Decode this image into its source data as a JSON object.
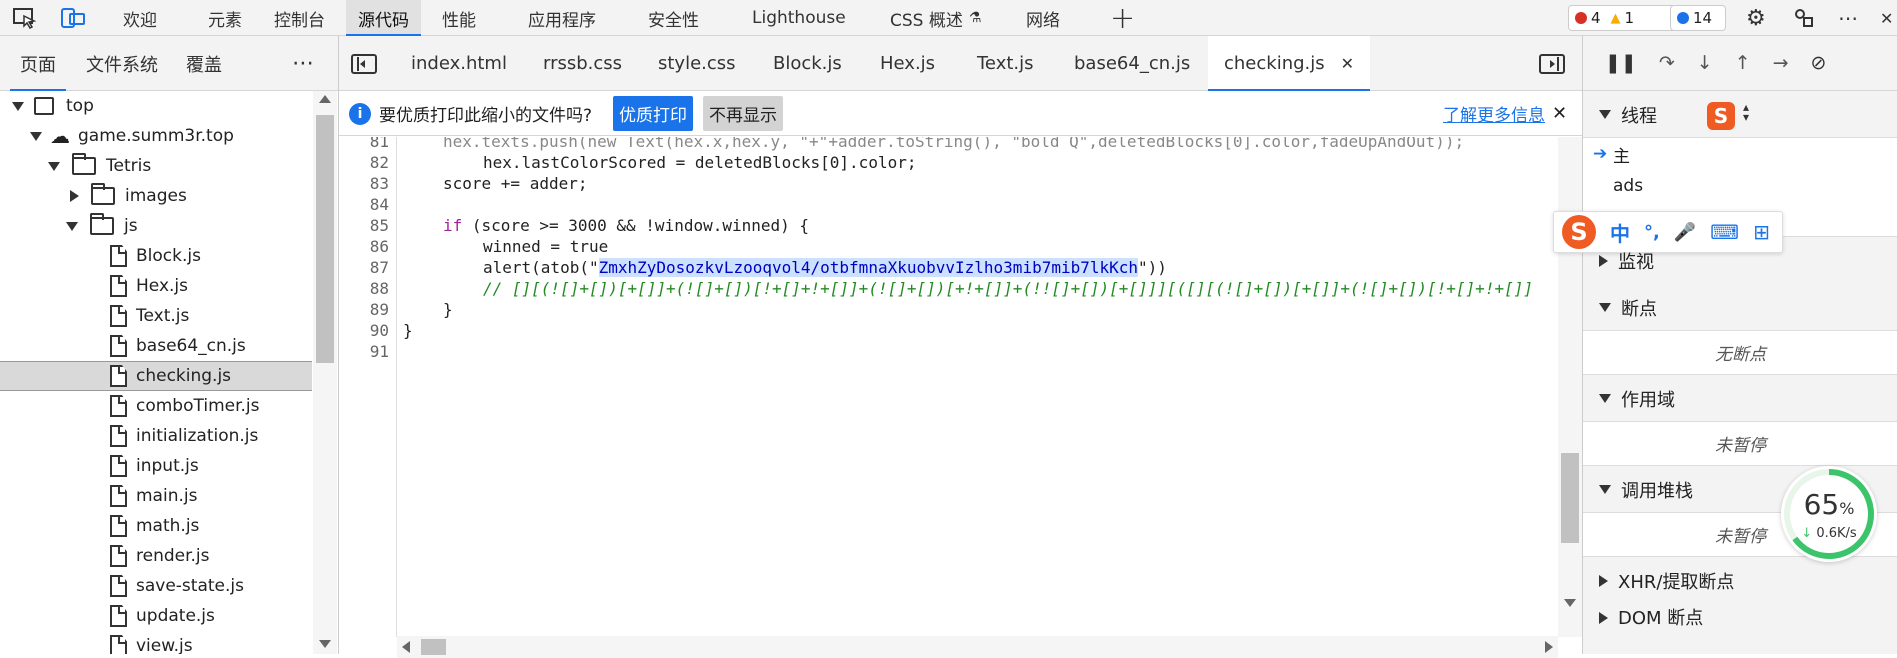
{
  "panel_tabs": [
    "欢迎",
    "元素",
    "控制台",
    "源代码",
    "性能",
    "应用程序",
    "安全性",
    "Lighthouse",
    "CSS 概述",
    "网络"
  ],
  "badges": {
    "errors": "4",
    "warnings": "1",
    "messages": "14"
  },
  "left": {
    "tabs": [
      "页面",
      "文件系统",
      "覆盖"
    ],
    "tree": [
      "top",
      "game.summ3r.top",
      "Tetris",
      "images",
      "js",
      "Block.js",
      "Hex.js",
      "Text.js",
      "base64_cn.js",
      "checking.js",
      "comboTimer.js",
      "initialization.js",
      "input.js",
      "main.js",
      "math.js",
      "render.js",
      "save-state.js",
      "update.js",
      "view.js"
    ]
  },
  "file_tabs": [
    "index.html",
    "rrssb.css",
    "style.css",
    "Block.js",
    "Hex.js",
    "Text.js",
    "base64_cn.js",
    "checking.js"
  ],
  "infobar": {
    "text": "要优质打印此缩小的文件吗?",
    "primary": "优质打印",
    "secondary": "不再显示",
    "link": "了解更多信息"
  },
  "code": {
    "partial": "hex.texts.push(new Text(hex.x,hex.y, \"+\"+adder.toString(), \"bold Q\",deletedBlocks[0].color,fadeUpAndOut));",
    "numbers": [
      "81",
      "82",
      "83",
      "84",
      "85",
      "86",
      "87",
      "88",
      "89",
      "90",
      "91"
    ],
    "line82": "hex.lastColorScored = deletedBlocks[0].color;",
    "line83": "score += adder;",
    "cond": "(score >= 3000 && !window.winned) {",
    "winned": "winned = true",
    "alert_pre": "alert(atob(\"",
    "alert_str": "ZmxhZyDosozkvLzooqvol4/otbfmnaXkuobvvIzlho3mib7mib7lkKch",
    "alert_post": "\"))",
    "comment": "// [][(![]+[])[+[]]+(![]+[])[!+[]+!+[]]+(![]+[])[+!+[]]+(!![]+[])[+[]]][([][(![]+[])[+[]]+(![]+[])[!+[]+!+[]]",
    "close1": "}",
    "close2": "}"
  },
  "right": {
    "threads": "线程",
    "main": "主",
    "ads": "ads",
    "watch": "监视",
    "breakpoints": "断点",
    "no_bp": "无断点",
    "scope": "作用域",
    "not_paused": "未暂停",
    "callstack": "调用堆栈",
    "not_paused2": "未暂停",
    "xhr": "XHR/提取断点",
    "dom": "DOM 断点"
  },
  "ime": {
    "zh": "中",
    "punct": "°,"
  },
  "gauge": {
    "percent": 65,
    "pct_unit": "%",
    "rate": "0.6K/s"
  }
}
